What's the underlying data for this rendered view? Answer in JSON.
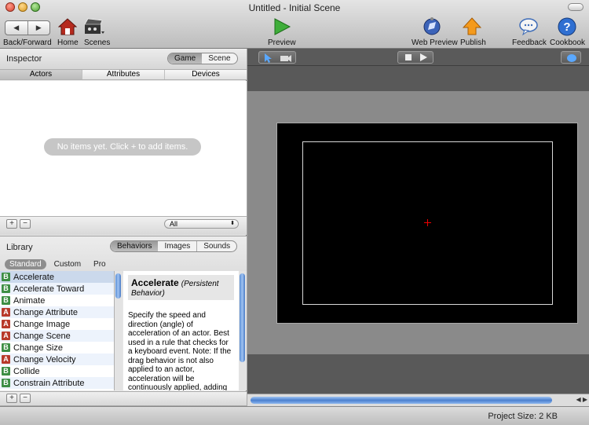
{
  "window": {
    "title": "Untitled - Initial Scene"
  },
  "toolbar": {
    "back_forward_label": "Back/Forward",
    "home_label": "Home",
    "scenes_label": "Scenes",
    "preview_label": "Preview",
    "web_preview_label": "Web Preview",
    "publish_label": "Publish",
    "feedback_label": "Feedback",
    "cookbook_label": "Cookbook"
  },
  "inspector": {
    "title": "Inspector",
    "modes": [
      "Game",
      "Scene"
    ],
    "tabs": [
      "Actors",
      "Attributes",
      "Devices"
    ],
    "empty_message": "No items yet. Click + to add items.",
    "filter_value": "All",
    "add_label": "+",
    "remove_label": "−"
  },
  "library": {
    "title": "Library",
    "tabs": [
      "Behaviors",
      "Images",
      "Sounds"
    ],
    "subtabs": [
      "Standard",
      "Custom",
      "Pro"
    ],
    "items": [
      {
        "badge": "B",
        "label": "Accelerate"
      },
      {
        "badge": "B",
        "label": "Accelerate Toward"
      },
      {
        "badge": "B",
        "label": "Animate"
      },
      {
        "badge": "A",
        "label": "Change Attribute"
      },
      {
        "badge": "A",
        "label": "Change Image"
      },
      {
        "badge": "A",
        "label": "Change Scene"
      },
      {
        "badge": "B",
        "label": "Change Size"
      },
      {
        "badge": "A",
        "label": "Change Velocity"
      },
      {
        "badge": "B",
        "label": "Collide"
      },
      {
        "badge": "B",
        "label": "Constrain Attribute"
      }
    ],
    "doc": {
      "title": "Accelerate",
      "subtitle": "(Persistent Behavior)",
      "text": "Specify the speed and direction (angle) of acceleration of an actor. Best used in a rule that checks for a keyboard event. Note: If the drag behavior is not also applied to an actor, acceleration will be continuously applied, adding"
    }
  },
  "status": {
    "project_size": "Project Size: 2 KB"
  },
  "colors": {
    "accent": "#4b80cf",
    "badge_behavior": "#3d8e44",
    "badge_action": "#b83a2b"
  }
}
